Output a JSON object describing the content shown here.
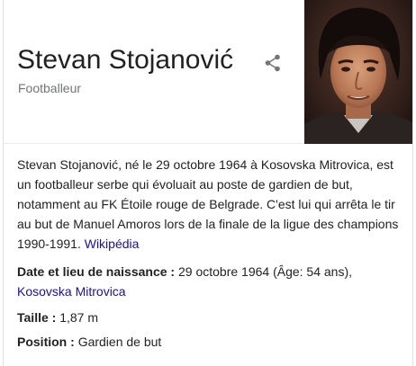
{
  "entity": {
    "name": "Stevan Stojanović",
    "type": "Footballeur"
  },
  "share_icon": "share-icon",
  "description": {
    "text": "Stevan Stojanović, né le 29 octobre 1964 à Kosovska Mitrovica, est un footballeur serbe qui évoluait au poste de gardien de but, notamment au FK Étoile rouge de Belgrade. C'est lui qui arrêta le tir au but de Manuel Amoros lors de la finale de la ligue des champions 1990-1991.",
    "source_link": "Wikipédia"
  },
  "facts": {
    "birth": {
      "label": "Date et lieu de naissance",
      "separator": " : ",
      "value": "29 octobre 1964 (Âge: 54 ans),",
      "link": "Kosovska Mitrovica"
    },
    "height": {
      "label": "Taille",
      "separator": " : ",
      "value": "1,87 m"
    },
    "position": {
      "label": "Position",
      "separator": " : ",
      "value": "Gardien de but"
    }
  },
  "colors": {
    "title": "#222222",
    "subtitle": "#70757a",
    "link": "#1a0dab",
    "border": "#dfe1e5"
  }
}
